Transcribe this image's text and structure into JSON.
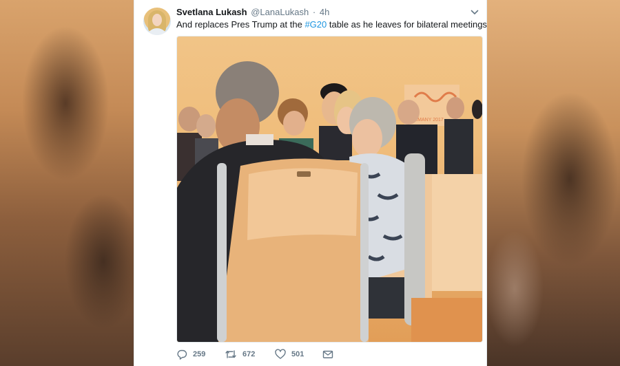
{
  "tweet": {
    "author_name": "Svetlana Lukash",
    "author_handle": "@LanaLukash",
    "separator": "·",
    "time": "4h",
    "text_before": "And replaces Pres Trump at the ",
    "hashtag": "#G20",
    "text_after": " table as he leaves for bilateral meetings",
    "photo_sign_text": "GERMANY 2017"
  },
  "actions": {
    "replies": "259",
    "retweets": "672",
    "likes": "501"
  },
  "icons": {
    "reply": "reply-icon",
    "retweet": "retweet-icon",
    "like": "heart-icon",
    "dm": "envelope-icon",
    "menu": "chevron-down-icon"
  },
  "colors": {
    "link": "#1b95e0",
    "text": "#14171a",
    "secondary": "#657786"
  }
}
